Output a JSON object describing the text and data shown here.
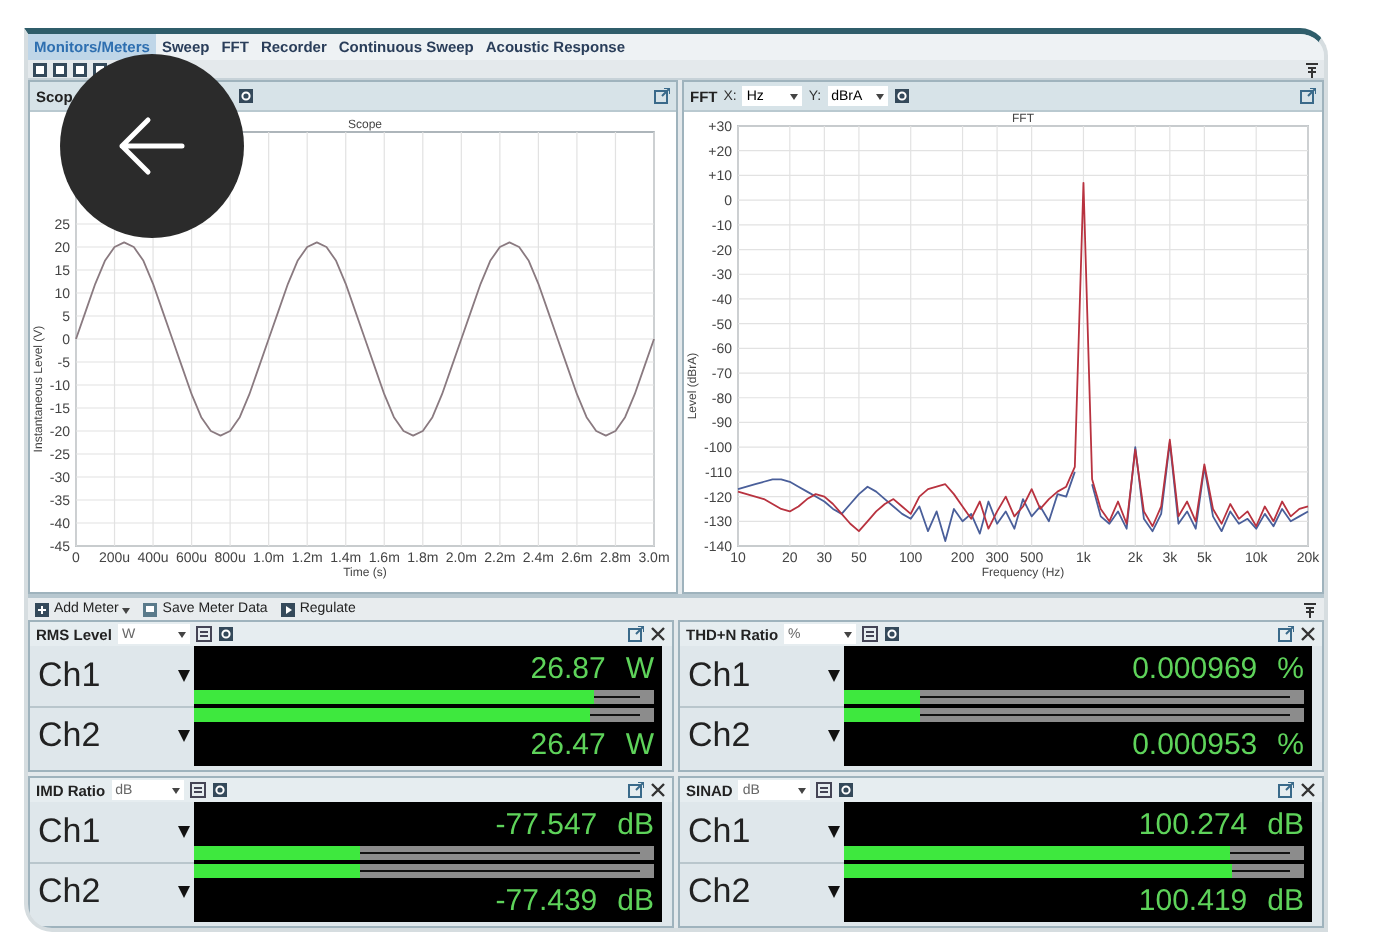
{
  "tabs": [
    {
      "label": "Monitors/Meters",
      "selected": true
    },
    {
      "label": "Sweep",
      "selected": false
    },
    {
      "label": "FFT",
      "selected": false
    },
    {
      "label": "Recorder",
      "selected": false
    },
    {
      "label": "Continuous Sweep",
      "selected": false
    },
    {
      "label": "Acoustic Response",
      "selected": false
    }
  ],
  "panels": [
    {
      "kind": "scope",
      "title": "Scop",
      "chart_data": {
        "type": "line",
        "title": "Scope",
        "xlabel": "Time (s)",
        "ylabel": "Instantaneous Level (V)",
        "categories": [
          "0",
          null,
          null,
          null,
          "200u",
          null,
          null,
          null,
          "400u",
          null,
          null,
          null,
          "600u",
          null,
          null,
          null,
          "800u",
          null,
          null,
          null,
          "1.0m",
          null,
          null,
          null,
          "1.2m",
          null,
          null,
          null,
          "1.4m",
          null,
          null,
          null,
          "1.6m",
          null,
          null,
          null,
          "1.8m",
          null,
          null,
          null,
          "2.0m",
          null,
          null,
          null,
          "2.2m",
          null,
          null,
          null,
          "2.4m",
          null,
          null,
          null,
          "2.6m",
          null,
          null,
          null,
          "2.8m",
          null,
          null,
          null,
          "3.0m"
        ],
        "series": [
          {
            "color": "#8a7a80",
            "values": [
              0,
              6,
              12,
              17,
              20,
              21,
              20,
              17,
              12,
              6,
              0,
              -6,
              -12,
              -17,
              -20,
              -21,
              -20,
              -17,
              -12,
              -6,
              0,
              6,
              12,
              17,
              20,
              21,
              20,
              17,
              12,
              6,
              0,
              -6,
              -12,
              -17,
              -20,
              -21,
              -20,
              -17,
              -12,
              -6,
              0,
              6,
              12,
              17,
              20,
              21,
              20,
              17,
              12,
              6,
              0,
              -6,
              -12,
              -17,
              -20,
              -21,
              -20,
              -17,
              -12,
              -6,
              0
            ]
          }
        ],
        "ylim": [
          -45,
          45
        ],
        "grid": true,
        "yticks": [
          25,
          20,
          15,
          10,
          5,
          0,
          -5,
          -10,
          -15,
          -20,
          -25,
          -30,
          -35,
          -40,
          -45
        ]
      }
    },
    {
      "kind": "fft",
      "title": "FFT",
      "x_label": "X:",
      "x_unit": "Hz",
      "y_label": "Y:",
      "y_unit": "dBrA",
      "chart_data": {
        "type": "line",
        "title": "FFT",
        "xlabel": "Frequency (Hz)",
        "ylabel": "Level (dBrA)",
        "categories": [
          "10",
          null,
          null,
          null,
          null,
          null,
          "20",
          null,
          null,
          null,
          "30",
          null,
          null,
          null,
          "50",
          null,
          null,
          null,
          null,
          null,
          "100",
          null,
          null,
          null,
          null,
          null,
          "200",
          null,
          null,
          null,
          "300",
          null,
          null,
          null,
          "500",
          null,
          null,
          null,
          null,
          null,
          "1k",
          null,
          null,
          null,
          null,
          null,
          "2k",
          null,
          null,
          null,
          "3k",
          null,
          null,
          null,
          "5k",
          null,
          null,
          null,
          null,
          null,
          "10k",
          null,
          null,
          null,
          null,
          null,
          "20k"
        ],
        "series": [
          {
            "color": "#4a5f9a",
            "values": [
              -117,
              -116,
              -115,
              -114,
              -113,
              -113,
              -114,
              -116,
              -118,
              -120,
              -122,
              -125,
              -127,
              -123,
              -119,
              -116,
              -118,
              -121,
              -124,
              -127,
              -129,
              -124,
              -134,
              -126,
              -138,
              -125,
              -130,
              -127,
              -135,
              -122,
              -131,
              -126,
              -133,
              -121,
              -128,
              -124,
              -130,
              -119,
              -120,
              -110,
              null,
              -115,
              -128,
              -131,
              -126,
              -133,
              -100,
              -129,
              -134,
              -127,
              -98,
              -131,
              -126,
              -133,
              -108,
              -128,
              -134,
              -126,
              -131,
              -129,
              -133,
              -127,
              -132,
              -125,
              -130,
              -128,
              -126
            ]
          },
          {
            "color": "#b8323f",
            "values": [
              -118,
              -119,
              -120,
              -121,
              -123,
              -125,
              -126,
              -124,
              -121,
              -119,
              -120,
              -123,
              -127,
              -131,
              -134,
              -130,
              -126,
              -123,
              -121,
              -124,
              -127,
              -120,
              -117,
              -116,
              -115,
              -119,
              -124,
              -129,
              -122,
              -133,
              -126,
              -120,
              -128,
              -124,
              -117,
              -125,
              -121,
              -118,
              -116,
              -108,
              7,
              -113,
              -125,
              -130,
              -122,
              -131,
              -101,
              -126,
              -132,
              -124,
              -97,
              -128,
              -122,
              -130,
              -107,
              -125,
              -131,
              -123,
              -129,
              -126,
              -132,
              -124,
              -130,
              -122,
              -128,
              -125,
              -124
            ]
          }
        ],
        "ylim": [
          -140,
          30
        ],
        "grid": true,
        "yticks": [
          {
            "value": 30,
            "label": "+30"
          },
          {
            "value": 20,
            "label": "+20"
          },
          {
            "value": 10,
            "label": "+10"
          },
          0,
          -10,
          -20,
          -30,
          -40,
          -50,
          -60,
          -70,
          -80,
          -90,
          -100,
          -110,
          -120,
          -130,
          -140
        ]
      }
    }
  ],
  "meter_toolbar": {
    "buttons": [
      "Add Meter",
      "Save Meter Data",
      "Regulate"
    ]
  },
  "meters": [
    {
      "title": "RMS Level",
      "unit_select": "W",
      "channels": [
        {
          "name": "Ch1",
          "value": "26.87",
          "unit": "W",
          "level": 0.87
        },
        {
          "name": "Ch2",
          "value": "26.47",
          "unit": "W",
          "level": 0.86
        }
      ]
    },
    {
      "title": "THD+N Ratio",
      "unit_select": "%",
      "channels": [
        {
          "name": "Ch1",
          "value": "0.000969",
          "unit": "%",
          "level": 0.165
        },
        {
          "name": "Ch2",
          "value": "0.000953",
          "unit": "%",
          "level": 0.165
        }
      ]
    },
    {
      "title": "IMD Ratio",
      "unit_select": "dB",
      "channels": [
        {
          "name": "Ch1",
          "value": "-77.547",
          "unit": "dB",
          "level": 0.36
        },
        {
          "name": "Ch2",
          "value": "-77.439",
          "unit": "dB",
          "level": 0.36
        }
      ]
    },
    {
      "title": "SINAD",
      "unit_select": "dB",
      "channels": [
        {
          "name": "Ch1",
          "value": "100.274",
          "unit": "dB",
          "level": 0.84
        },
        {
          "name": "Ch2",
          "value": "100.419",
          "unit": "dB",
          "level": 0.845
        }
      ]
    }
  ]
}
